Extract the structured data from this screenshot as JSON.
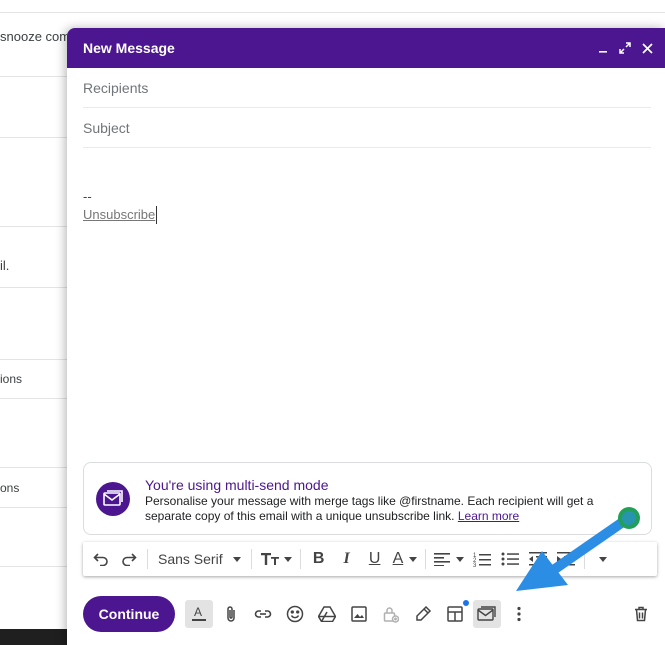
{
  "background": {
    "rows": [
      "snooze com",
      "il.",
      "ions",
      "ons"
    ]
  },
  "compose": {
    "title": "New Message",
    "header_icons": [
      "minimize-icon",
      "expand-icon",
      "close-icon"
    ],
    "recipients_placeholder": "Recipients",
    "subject_placeholder": "Subject",
    "signature_dash": "--",
    "unsubscribe_text": "Unsubscribe"
  },
  "banner": {
    "title": "You're using multi-send mode",
    "description": "Personalise your message with merge tags like @firstname. Each recipient will get a separate copy of this email with a unique unsubscribe link.",
    "link": "Learn more"
  },
  "format_toolbar": {
    "font": "Sans Serif",
    "buttons": [
      "undo-icon",
      "redo-icon",
      "font-family-select",
      "font-size-icon",
      "bold-icon",
      "italic-icon",
      "underline-icon",
      "text-color-icon",
      "align-icon",
      "numbered-list-icon",
      "bulleted-list-icon",
      "indent-less-icon",
      "indent-more-icon",
      "more-formatting-icon"
    ]
  },
  "bottom_toolbar": {
    "continue_label": "Continue",
    "buttons": [
      "formatting-icon",
      "attach-icon",
      "link-icon",
      "emoji-icon",
      "drive-icon",
      "photo-icon",
      "confidential-icon",
      "signature-icon",
      "layouts-icon",
      "multi-send-icon",
      "more-options-icon",
      "trash-icon"
    ]
  },
  "colors": {
    "accent": "#4b168f",
    "arrow": "#2b8ee4",
    "dot": "#1a73e8"
  }
}
